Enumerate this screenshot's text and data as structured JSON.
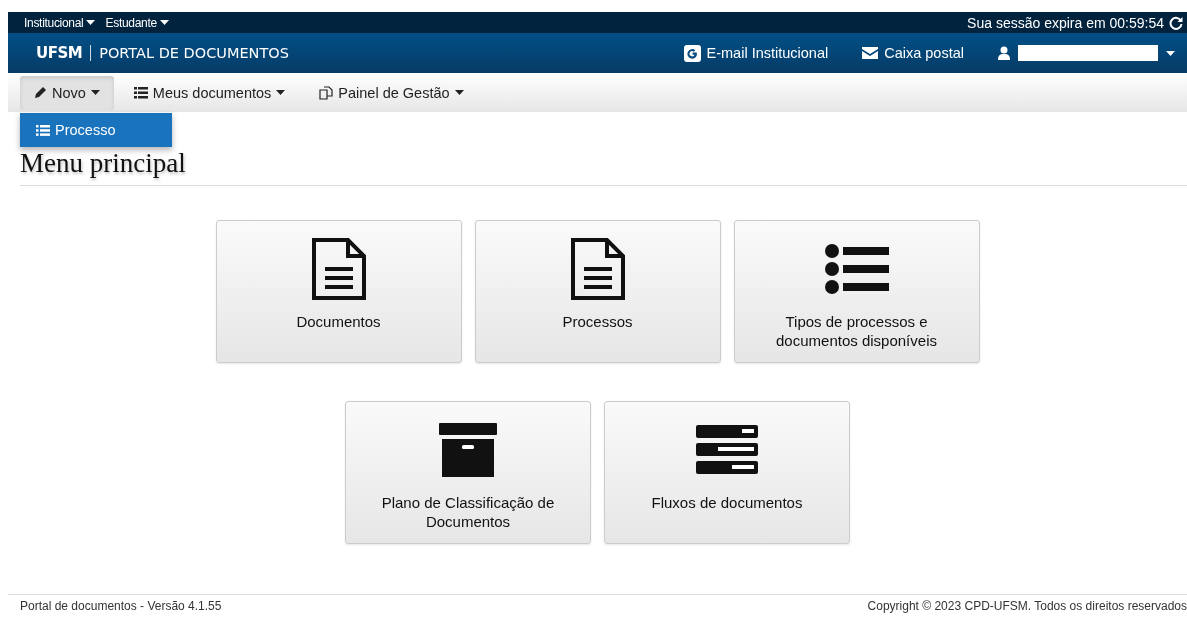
{
  "top_bar": {
    "menus": [
      {
        "label": "Institucional"
      },
      {
        "label": "Estudante"
      }
    ],
    "session": "Sua sessão expira em 00:59:54"
  },
  "header": {
    "brand": "UFSM",
    "title": "PORTAL DE DOCUMENTOS",
    "links": [
      {
        "kind": "google",
        "label": "E-mail Institucional"
      },
      {
        "kind": "mail",
        "label": "Caixa postal"
      }
    ]
  },
  "nav": [
    {
      "kind": "pencil",
      "label": "Novo",
      "expanded": true,
      "menu": [
        {
          "label": "Processo"
        }
      ]
    },
    {
      "kind": "list",
      "label": "Meus documentos",
      "expanded": false
    },
    {
      "kind": "copy",
      "label": "Painel de Gestão",
      "expanded": false
    }
  ],
  "heading": "Menu principal",
  "card_rows": [
    [
      {
        "kind": "document",
        "label": "Documentos"
      },
      {
        "kind": "document",
        "label": "Processos"
      },
      {
        "kind": "list",
        "label": "Tipos de processos e documentos disponíveis"
      }
    ],
    [
      {
        "kind": "archive",
        "label": "Plano de Classificação de Documentos"
      },
      {
        "kind": "server",
        "label": "Fluxos de documentos"
      }
    ]
  ],
  "footer": {
    "version": "Portal de documentos - Versão 4.1.55",
    "copyright": "Copyright © 2023 CPD-UFSM. Todos os direitos reservados"
  }
}
